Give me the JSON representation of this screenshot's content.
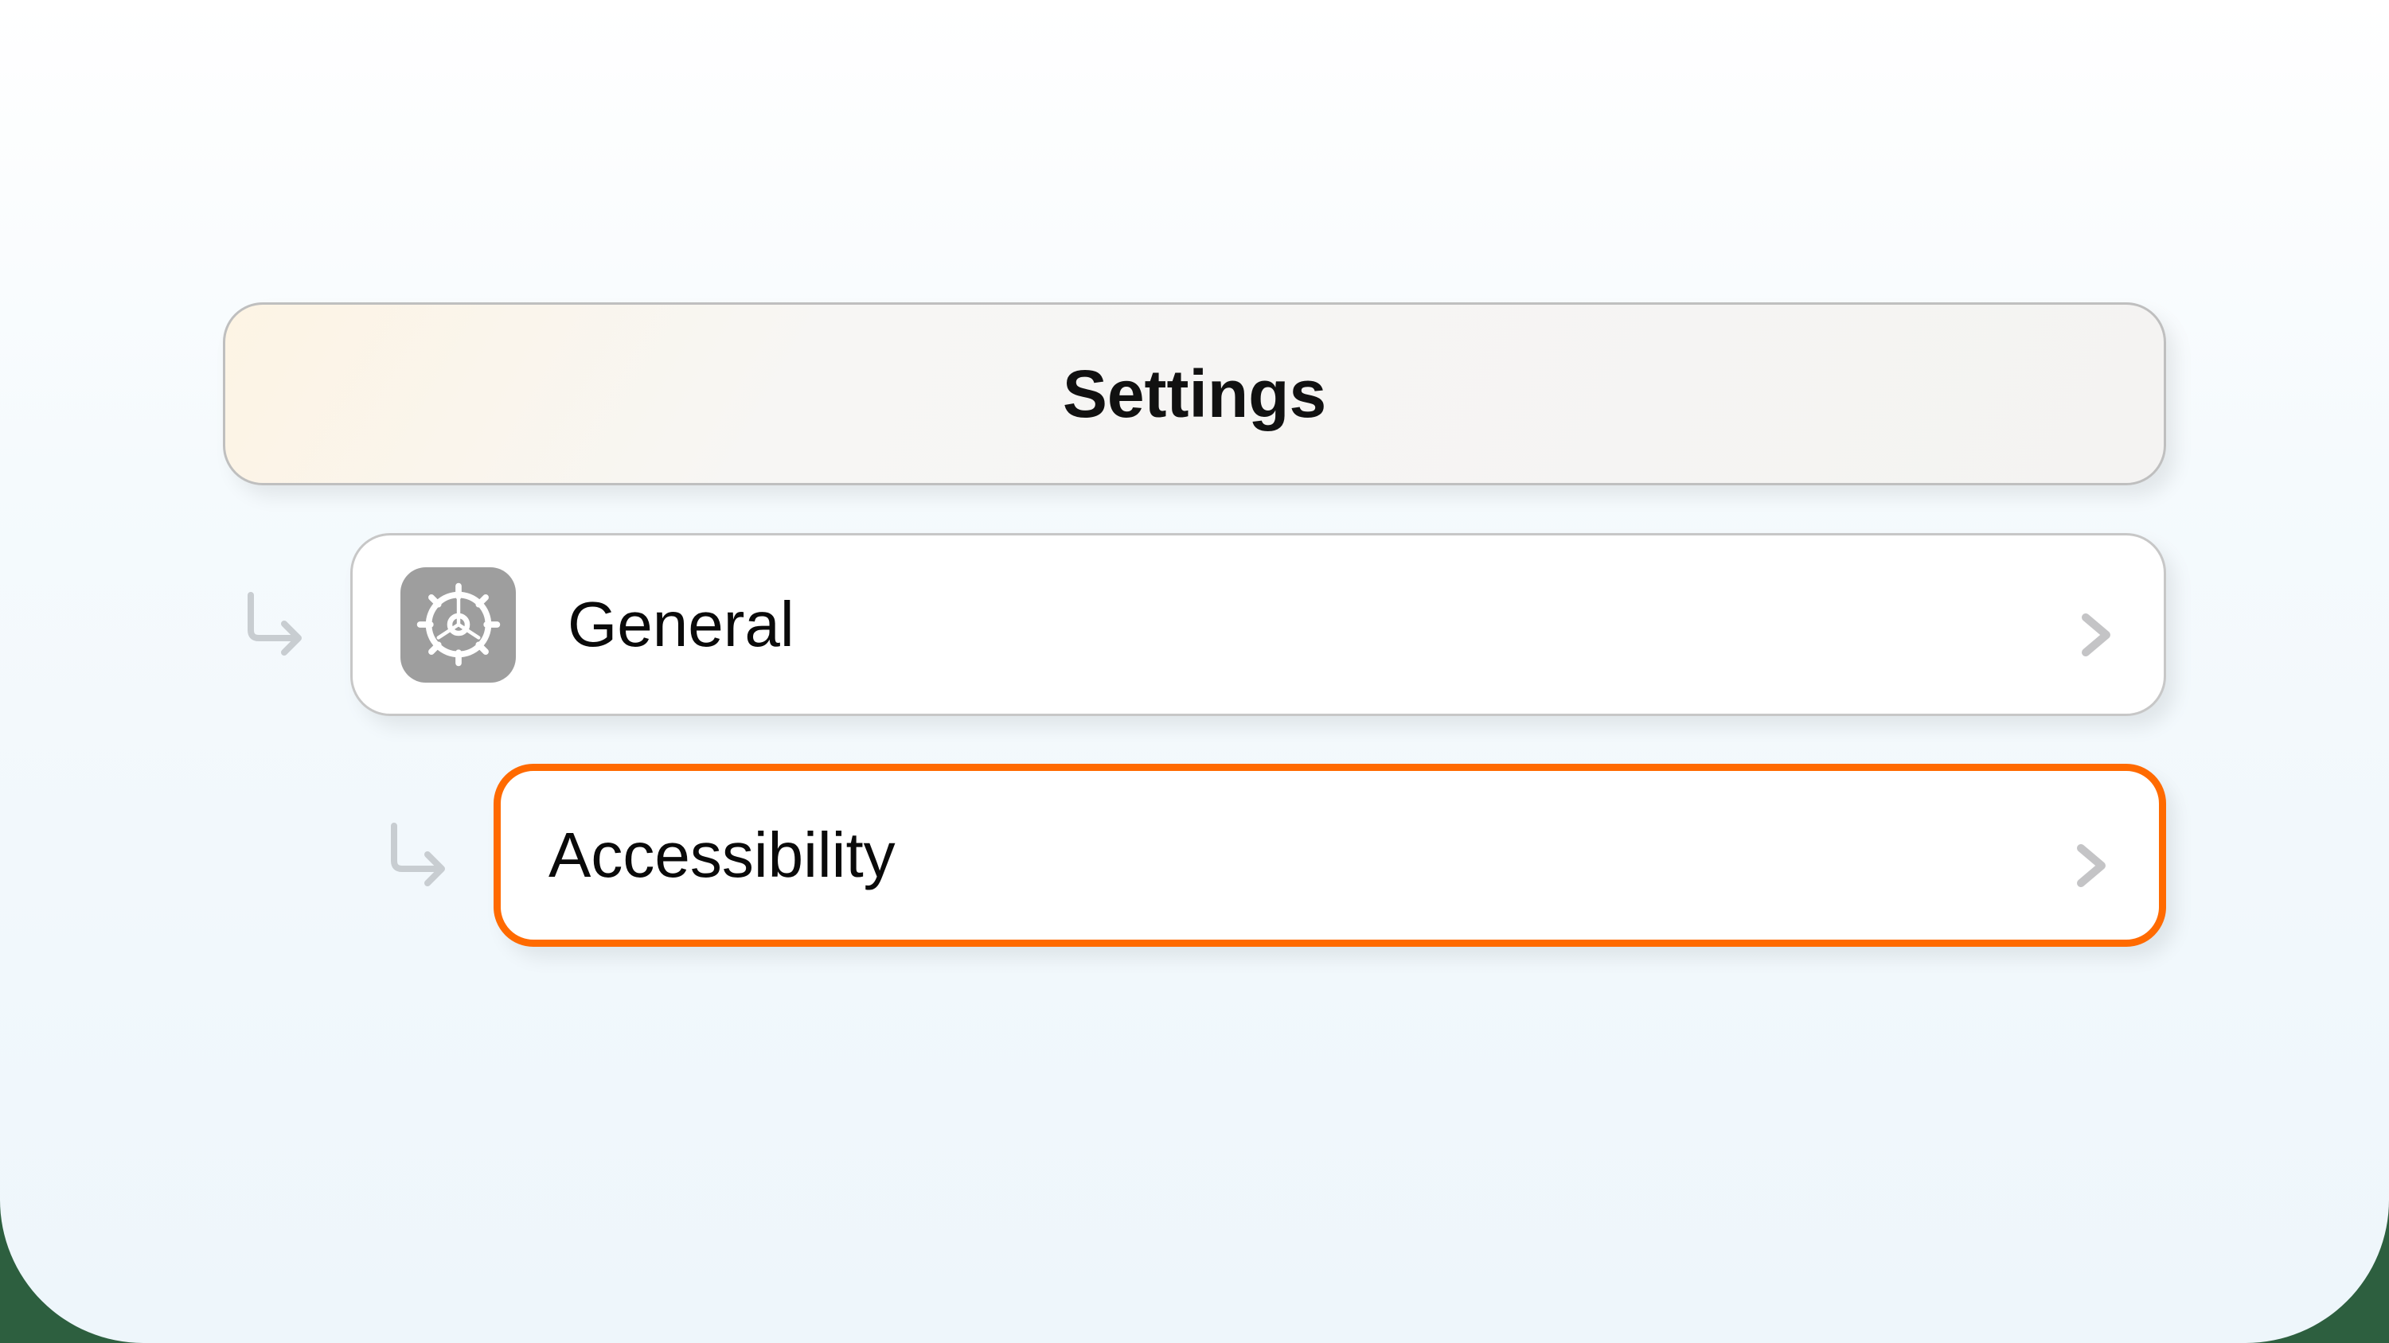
{
  "breadcrumb": {
    "root": {
      "label": "Settings"
    },
    "level1": {
      "label": "General",
      "icon": "gear-icon"
    },
    "level2": {
      "label": "Accessibility",
      "highlighted": true,
      "highlight_color": "#ff6a00"
    }
  }
}
